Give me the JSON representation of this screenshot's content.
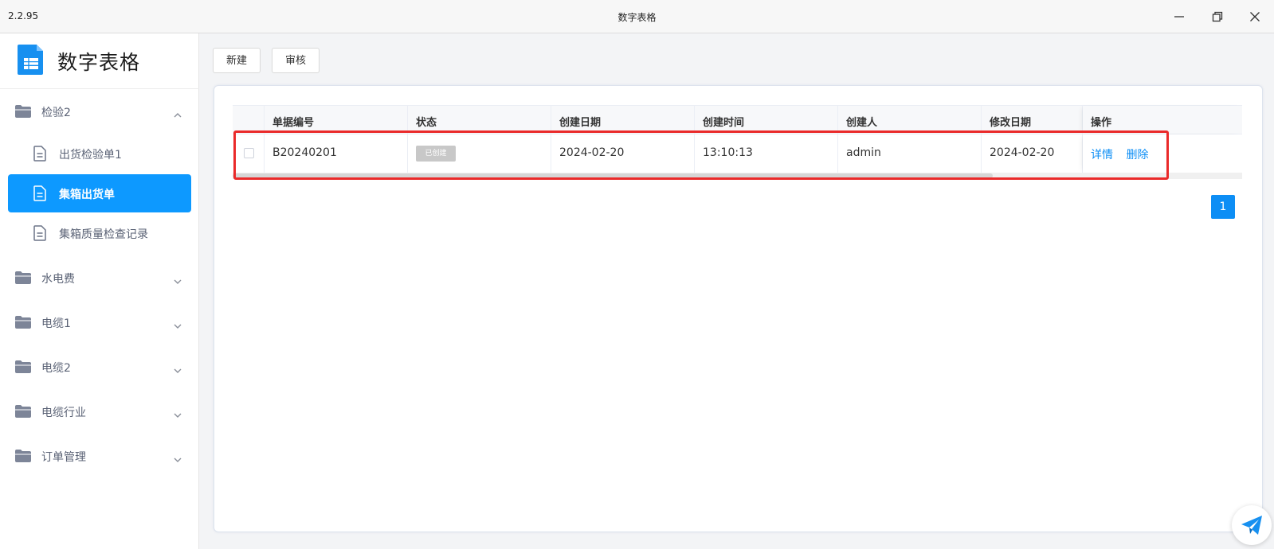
{
  "window": {
    "version": "2.2.95",
    "title": "数字表格"
  },
  "app": {
    "name": "数字表格",
    "accent": "#0d99ff"
  },
  "sidebar": {
    "groups": [
      {
        "label": "检验2",
        "expanded": true
      },
      {
        "label": "水电费",
        "expanded": false
      },
      {
        "label": "电缆1",
        "expanded": false
      },
      {
        "label": "电缆2",
        "expanded": false
      },
      {
        "label": "电缆行业",
        "expanded": false
      },
      {
        "label": "订单管理",
        "expanded": false
      }
    ],
    "items": [
      {
        "label": "出货检验单1",
        "active": false
      },
      {
        "label": "集箱出货单",
        "active": true
      },
      {
        "label": "集箱质量检查记录",
        "active": false
      }
    ]
  },
  "toolbar": {
    "new_label": "新建",
    "audit_label": "审核"
  },
  "table": {
    "columns": [
      "单据编号",
      "状态",
      "创建日期",
      "创建时间",
      "创建人",
      "修改日期",
      "操作"
    ],
    "rows": [
      {
        "doc_no": "B20240201",
        "status": "已创建",
        "created_date": "2024-02-20",
        "created_time": "13:10:13",
        "creator": "admin",
        "modified_date": "2024-02-20",
        "actions": [
          "详情",
          "删除"
        ]
      }
    ]
  },
  "pagination": {
    "current": "1"
  }
}
